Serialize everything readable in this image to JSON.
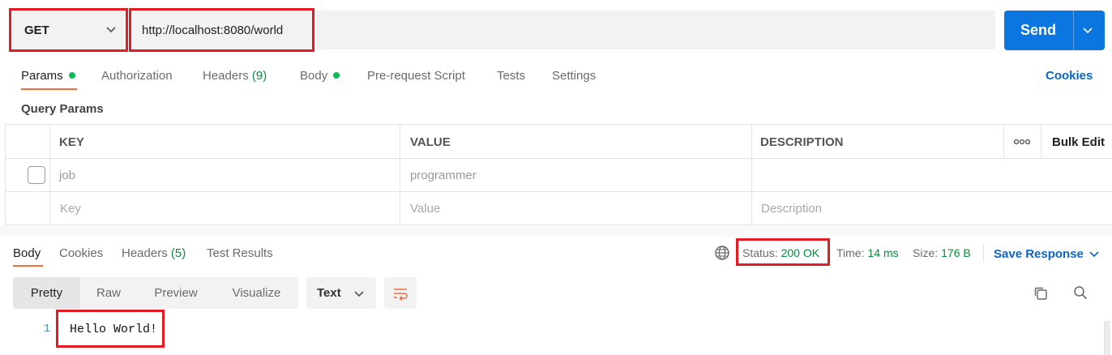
{
  "request": {
    "method": "GET",
    "url": "http://localhost:8080/world",
    "send_label": "Send"
  },
  "request_tabs": [
    {
      "label": "Params",
      "dot": true
    },
    {
      "label": "Authorization"
    },
    {
      "label": "Headers",
      "count": "(9)"
    },
    {
      "label": "Body",
      "dot": true
    },
    {
      "label": "Pre-request Script"
    },
    {
      "label": "Tests"
    },
    {
      "label": "Settings"
    }
  ],
  "cookies_link": "Cookies",
  "query_params": {
    "title": "Query Params",
    "columns": [
      "KEY",
      "VALUE",
      "DESCRIPTION"
    ],
    "bulk_edit": "Bulk Edit",
    "rows": [
      {
        "key": "job",
        "value": "programmer",
        "description": ""
      }
    ],
    "placeholder": {
      "key": "Key",
      "value": "Value",
      "description": "Description"
    }
  },
  "response_tabs": [
    {
      "label": "Body"
    },
    {
      "label": "Cookies"
    },
    {
      "label": "Headers",
      "count": "(5)"
    },
    {
      "label": "Test Results"
    }
  ],
  "response_meta": {
    "status_label": "Status:",
    "status_value": "200 OK",
    "time_label": "Time:",
    "time_value": "14 ms",
    "size_label": "Size:",
    "size_value": "176 B",
    "save_response": "Save Response"
  },
  "view_modes": [
    "Pretty",
    "Raw",
    "Preview",
    "Visualize"
  ],
  "format": "Text",
  "body_lines": [
    {
      "n": "1",
      "text": "Hello World!"
    }
  ],
  "colors": {
    "accent_orange": "#f26b3a",
    "send_blue": "#0b76e0",
    "link_blue": "#0b66c8",
    "status_green": "#0a8a3b",
    "highlight_red": "#e31b23"
  }
}
